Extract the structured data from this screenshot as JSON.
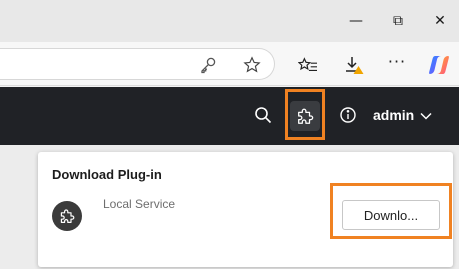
{
  "window_controls": {
    "minimize_glyph": "—",
    "maximize_glyph": "⧉",
    "close_glyph": "✕"
  },
  "toolbar": {
    "icons": [
      "key-icon",
      "star-icon",
      "favorites-icon",
      "downloads-icon",
      "more-icon",
      "copilot-icon"
    ],
    "more_glyph": "···"
  },
  "header": {
    "icons": [
      "search-icon",
      "plugin-icon",
      "info-icon",
      "chevron-down-icon"
    ],
    "user_label": "admin"
  },
  "plugin_card": {
    "title": "Download Plug-in",
    "service_name": "Local Service",
    "download_button_label": "Downlo..."
  },
  "colors": {
    "highlight": "#f08222",
    "header_bg": "#202226",
    "warning": "#f0a500"
  }
}
